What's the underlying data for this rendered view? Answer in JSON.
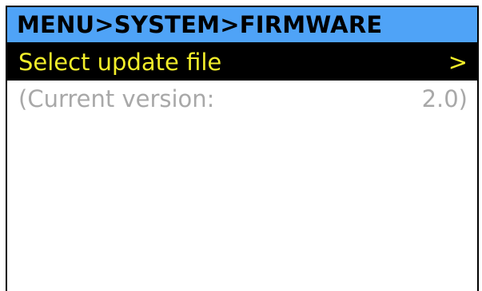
{
  "header": {
    "title": "MENU>SYSTEM>FIRMWARE"
  },
  "menu": {
    "items": [
      {
        "label": "Select update file",
        "value": ">"
      },
      {
        "label": "(Current version:",
        "value": "2.0)"
      }
    ]
  },
  "colors": {
    "header_bg": "#4fa3f7",
    "selected_bg": "#000000",
    "selected_text": "#f2ee2a",
    "info_text": "#a8a8a8"
  }
}
